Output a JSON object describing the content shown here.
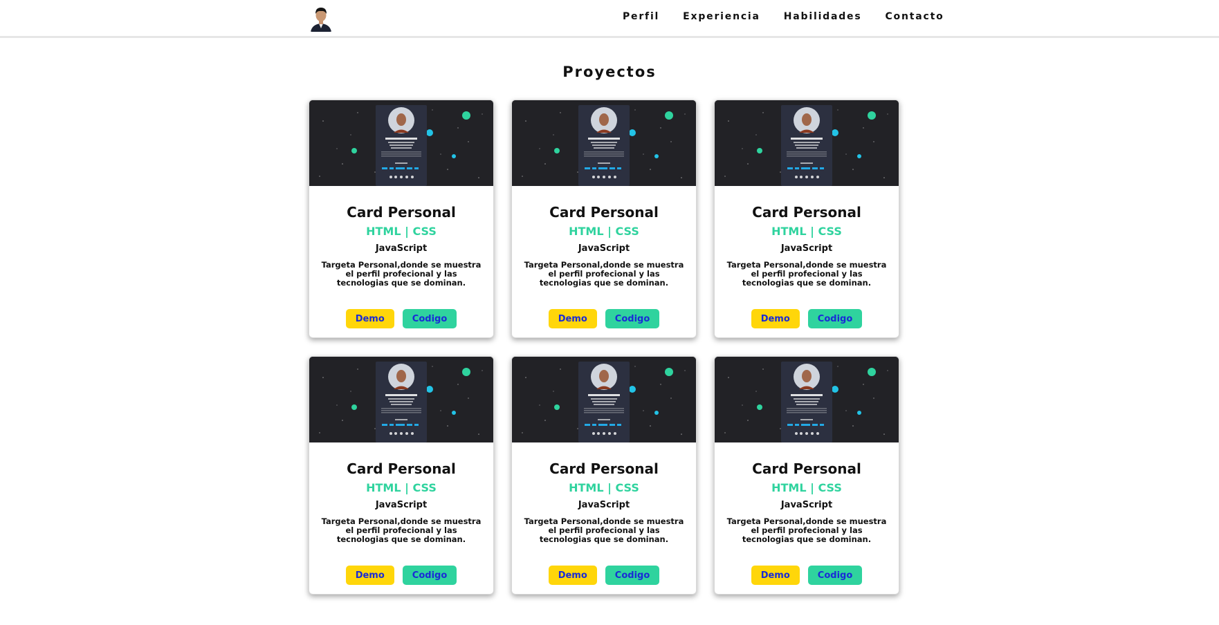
{
  "nav": {
    "items": [
      {
        "label": "Perfil"
      },
      {
        "label": "Experiencia"
      },
      {
        "label": "Habilidades"
      },
      {
        "label": "Contacto"
      }
    ]
  },
  "projects": {
    "title": "Proyectos",
    "cards": [
      {
        "title": "Card Personal",
        "tech_primary": "HTML | CSS",
        "tech_secondary": "JavaScript",
        "description": "Targeta Personal,donde se muestra el perfil profecional y las tecnologias que se dominan.",
        "demo_label": "Demo",
        "code_label": "Codigo"
      },
      {
        "title": "Card Personal",
        "tech_primary": "HTML | CSS",
        "tech_secondary": "JavaScript",
        "description": "Targeta Personal,donde se muestra el perfil profecional y las tecnologias que se dominan.",
        "demo_label": "Demo",
        "code_label": "Codigo"
      },
      {
        "title": "Card Personal",
        "tech_primary": "HTML | CSS",
        "tech_secondary": "JavaScript",
        "description": "Targeta Personal,donde se muestra el perfil profecional y las tecnologias que se dominan.",
        "demo_label": "Demo",
        "code_label": "Codigo"
      },
      {
        "title": "Card Personal",
        "tech_primary": "HTML | CSS",
        "tech_secondary": "JavaScript",
        "description": "Targeta Personal,donde se muestra el perfil profecional y las tecnologias que se dominan.",
        "demo_label": "Demo",
        "code_label": "Codigo"
      },
      {
        "title": "Card Personal",
        "tech_primary": "HTML | CSS",
        "tech_secondary": "JavaScript",
        "description": "Targeta Personal,donde se muestra el perfil profecional y las tecnologias que se dominan.",
        "demo_label": "Demo",
        "code_label": "Codigo"
      },
      {
        "title": "Card Personal",
        "tech_primary": "HTML | CSS",
        "tech_secondary": "JavaScript",
        "description": "Targeta Personal,donde se muestra el perfil profecional y las tecnologias que se dominan.",
        "demo_label": "Demo",
        "code_label": "Codigo"
      }
    ]
  },
  "colors": {
    "accent_green": "#2fd39e",
    "demo_yellow": "#ffd60a",
    "button_text": "#1a2bd6",
    "thumb_bg": "#222226"
  }
}
